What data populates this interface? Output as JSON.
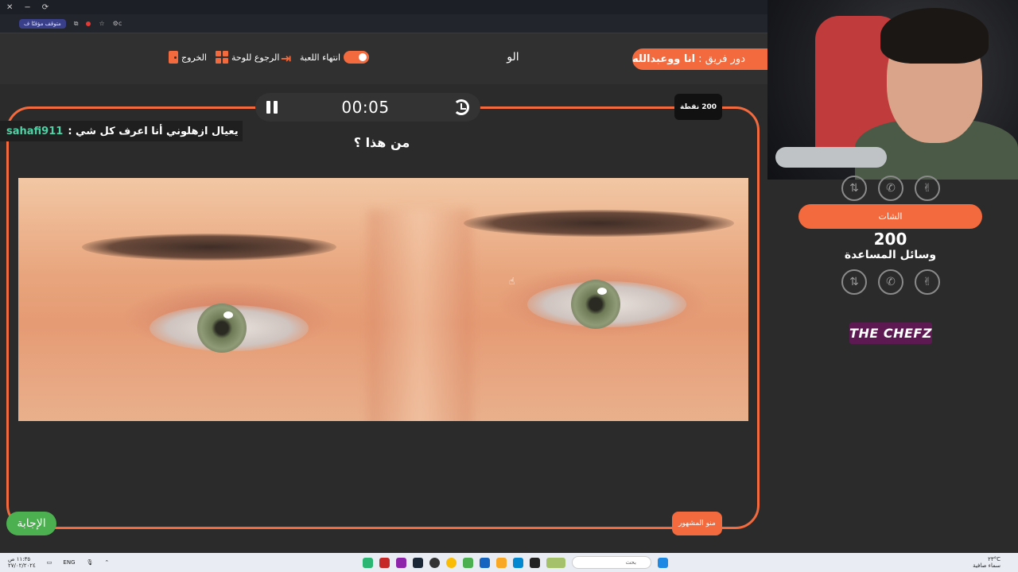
{
  "browser": {
    "window_buttons": [
      "✕",
      "−",
      "⟳"
    ],
    "paused_label": "متوقف مؤقتًا",
    "ext_label": "ف",
    "address_text": "⚙c"
  },
  "header": {
    "team_turn_prefix": "دور فريق :",
    "team_name": "انا ووعبدالله",
    "word": "الو",
    "end_game_label": "انتهاء اللعبة",
    "back_to_board_label": "الرجوع للوحة",
    "exit_label": "الخروج"
  },
  "board": {
    "timer": "00:05",
    "points_badge": "200 نقطة",
    "chat_user": "sahafi911",
    "chat_message": ": يعيال ازهلوني أنا اعرف كل شي",
    "question": "من هذا ؟",
    "answer_button": "الإجابة",
    "category_button": "منو المشهور"
  },
  "side_panel": {
    "team_button": "الشات",
    "team_score": "200",
    "helpers_label": "وسائل المساعدة",
    "lifeline_icons": [
      "swap-icon",
      "phone-icon",
      "peace-hand-icon"
    ],
    "brand": "THE CHEFZ"
  },
  "taskbar": {
    "left_time": "١١:٣٥ ص",
    "left_date": "٢٧/٠٢/٢٠٢٤",
    "lang": "ENG",
    "search_placeholder": "بحث",
    "weather_temp": "٢٣°C",
    "weather_desc": "سماء صافية"
  },
  "colors": {
    "accent": "#f26a3d",
    "answer_green": "#4caf50",
    "chat_user": "#4fd1a5",
    "brand_bg": "#5d1a52"
  }
}
